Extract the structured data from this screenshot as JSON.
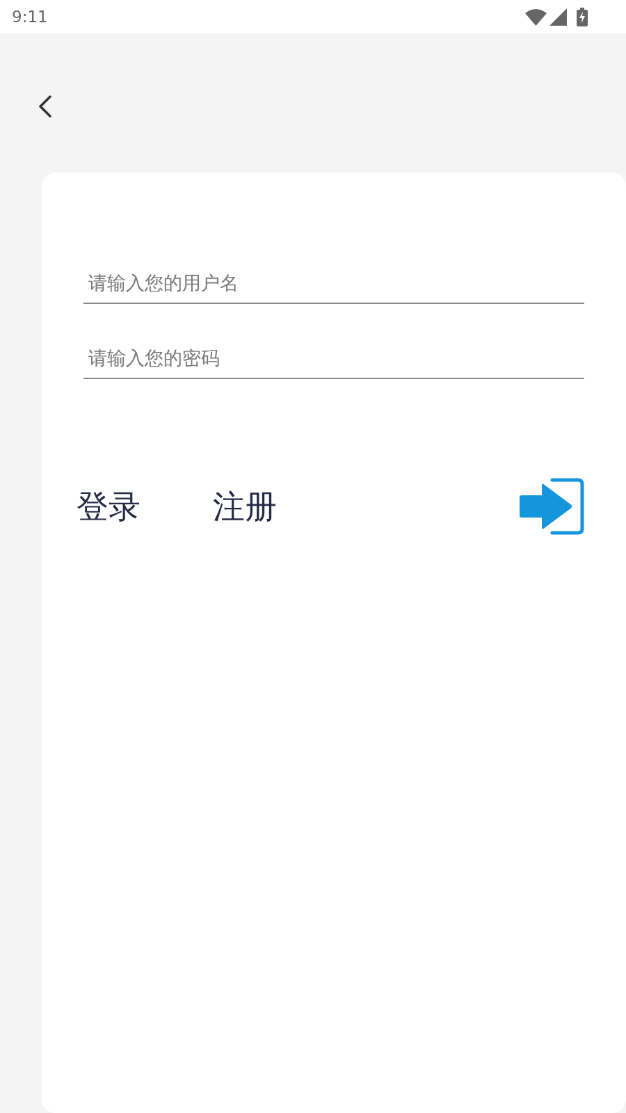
{
  "status_bar": {
    "time": "9:11"
  },
  "login_form": {
    "fields": [
      {
        "placeholder": "请输入您的用户名"
      },
      {
        "placeholder": "请输入您的密码"
      }
    ]
  },
  "mode_tabs": [
    {
      "label": "登录"
    },
    {
      "label": "注册"
    }
  ]
}
